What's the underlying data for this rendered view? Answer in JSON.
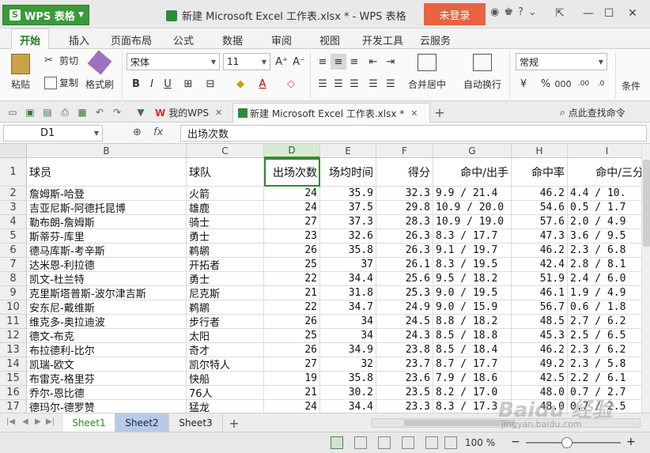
{
  "app": {
    "menu_label": "WPS 表格",
    "doc_title": "新建 Microsoft Excel 工作表.xlsx * - WPS 表格",
    "login_label": "未登录"
  },
  "ribbon_tabs": [
    "开始",
    "插入",
    "页面布局",
    "公式",
    "数据",
    "审阅",
    "视图",
    "开发工具",
    "云服务"
  ],
  "ribbon": {
    "paste": "粘贴",
    "cut": "剪切",
    "copy": "复制",
    "format_painter": "格式刷",
    "font_name": "宋体",
    "font_size": "11",
    "merge_center": "合并居中",
    "wrap_text": "自动换行",
    "number_format": "常规",
    "cond_format": "条件"
  },
  "doc_tabs": {
    "home": "我的WPS",
    "file": "新建 Microsoft Excel 工作表.xlsx *",
    "search": "点此查找命令"
  },
  "formula_bar": {
    "cell_ref": "D1",
    "fx": "fx",
    "content": "出场次数"
  },
  "columns": [
    "B",
    "C",
    "D",
    "E",
    "F",
    "G",
    "H",
    "I"
  ],
  "rows": [
    {
      "n": "1",
      "b": "球员",
      "c": "球队",
      "d": "出场次数",
      "e": "场均时间",
      "f": "得分",
      "g": "命中/出手",
      "h": "命中率",
      "i": "命中/三分"
    },
    {
      "n": "2",
      "b": "詹姆斯-哈登",
      "c": "火箭",
      "d": "24",
      "e": "35.9",
      "f": "32.3",
      "g": "9.9 / 21.4",
      "h": "46.2",
      "i": "4.4 / 10."
    },
    {
      "n": "3",
      "b": "吉亚尼斯-阿德托昆博",
      "c": "雄鹿",
      "d": "24",
      "e": "37.5",
      "f": "29.8",
      "g": "10.9 / 20.0",
      "h": "54.6",
      "i": "0.5 / 1.7"
    },
    {
      "n": "4",
      "b": "勒布朗-詹姆斯",
      "c": "骑士",
      "d": "27",
      "e": "37.3",
      "f": "28.3",
      "g": "10.9 / 19.0",
      "h": "57.6",
      "i": "2.0 / 4.9"
    },
    {
      "n": "5",
      "b": "斯蒂芬-库里",
      "c": "勇士",
      "d": "23",
      "e": "32.6",
      "f": "26.3",
      "g": "8.3 / 17.7",
      "h": "47.3",
      "i": "3.6 / 9.5"
    },
    {
      "n": "6",
      "b": "德马库斯-考辛斯",
      "c": "鹈鹕",
      "d": "26",
      "e": "35.8",
      "f": "26.3",
      "g": "9.1 / 19.7",
      "h": "46.2",
      "i": "2.3 / 6.8"
    },
    {
      "n": "7",
      "b": "达米恩-利拉德",
      "c": "开拓者",
      "d": "25",
      "e": "37",
      "f": "26.1",
      "g": "8.3 / 19.5",
      "h": "42.4",
      "i": "2.8 / 8.1"
    },
    {
      "n": "8",
      "b": "凯文-杜兰特",
      "c": "勇士",
      "d": "22",
      "e": "34.4",
      "f": "25.6",
      "g": "9.5 / 18.2",
      "h": "51.9",
      "i": "2.4 / 6.0"
    },
    {
      "n": "9",
      "b": "克里斯塔普斯-波尔津吉斯",
      "c": "尼克斯",
      "d": "21",
      "e": "31.8",
      "f": "25.3",
      "g": "9.0 / 19.5",
      "h": "46.1",
      "i": "1.9 / 4.9"
    },
    {
      "n": "10",
      "b": "安东尼-戴维斯",
      "c": "鹈鹕",
      "d": "22",
      "e": "34.7",
      "f": "24.9",
      "g": "9.0 / 15.9",
      "h": "56.7",
      "i": "0.6 / 1.8"
    },
    {
      "n": "11",
      "b": "维克多-奥拉迪波",
      "c": "步行者",
      "d": "26",
      "e": "34",
      "f": "24.5",
      "g": "8.8 / 18.2",
      "h": "48.5",
      "i": "2.7 / 6.2"
    },
    {
      "n": "12",
      "b": "德文-布克",
      "c": "太阳",
      "d": "25",
      "e": "34",
      "f": "24.3",
      "g": "8.5 / 18.8",
      "h": "45.3",
      "i": "2.5 / 6.5"
    },
    {
      "n": "13",
      "b": "布拉德利-比尔",
      "c": "奇才",
      "d": "26",
      "e": "34.9",
      "f": "23.8",
      "g": "8.5 / 18.4",
      "h": "46.2",
      "i": "2.3 / 6.2"
    },
    {
      "n": "14",
      "b": "凯瑞-欧文",
      "c": "凯尔特人",
      "d": "27",
      "e": "32",
      "f": "23.7",
      "g": "8.7 / 17.7",
      "h": "49.2",
      "i": "2.3 / 5.8"
    },
    {
      "n": "15",
      "b": "布雷克-格里芬",
      "c": "快船",
      "d": "19",
      "e": "35.8",
      "f": "23.6",
      "g": "7.9 / 18.6",
      "h": "42.5",
      "i": "2.2 / 6.1"
    },
    {
      "n": "16",
      "b": "乔尔-恩比德",
      "c": "76人",
      "d": "21",
      "e": "30.2",
      "f": "23.5",
      "g": "8.2 / 17.0",
      "h": "48.0",
      "i": "0.7 / 2.7"
    },
    {
      "n": "17",
      "b": "德玛尔-德罗赞",
      "c": "猛龙",
      "d": "24",
      "e": "34.4",
      "f": "23.3",
      "g": "8.3 / 17.3",
      "h": "48.0",
      "i": "0.7 / 2.5"
    }
  ],
  "sheets": [
    "Sheet1",
    "Sheet2",
    "Sheet3"
  ],
  "status": {
    "zoom": "100 %"
  },
  "watermark": {
    "brand": "Baidu 经验",
    "url": "jingyan.baidu.com"
  }
}
